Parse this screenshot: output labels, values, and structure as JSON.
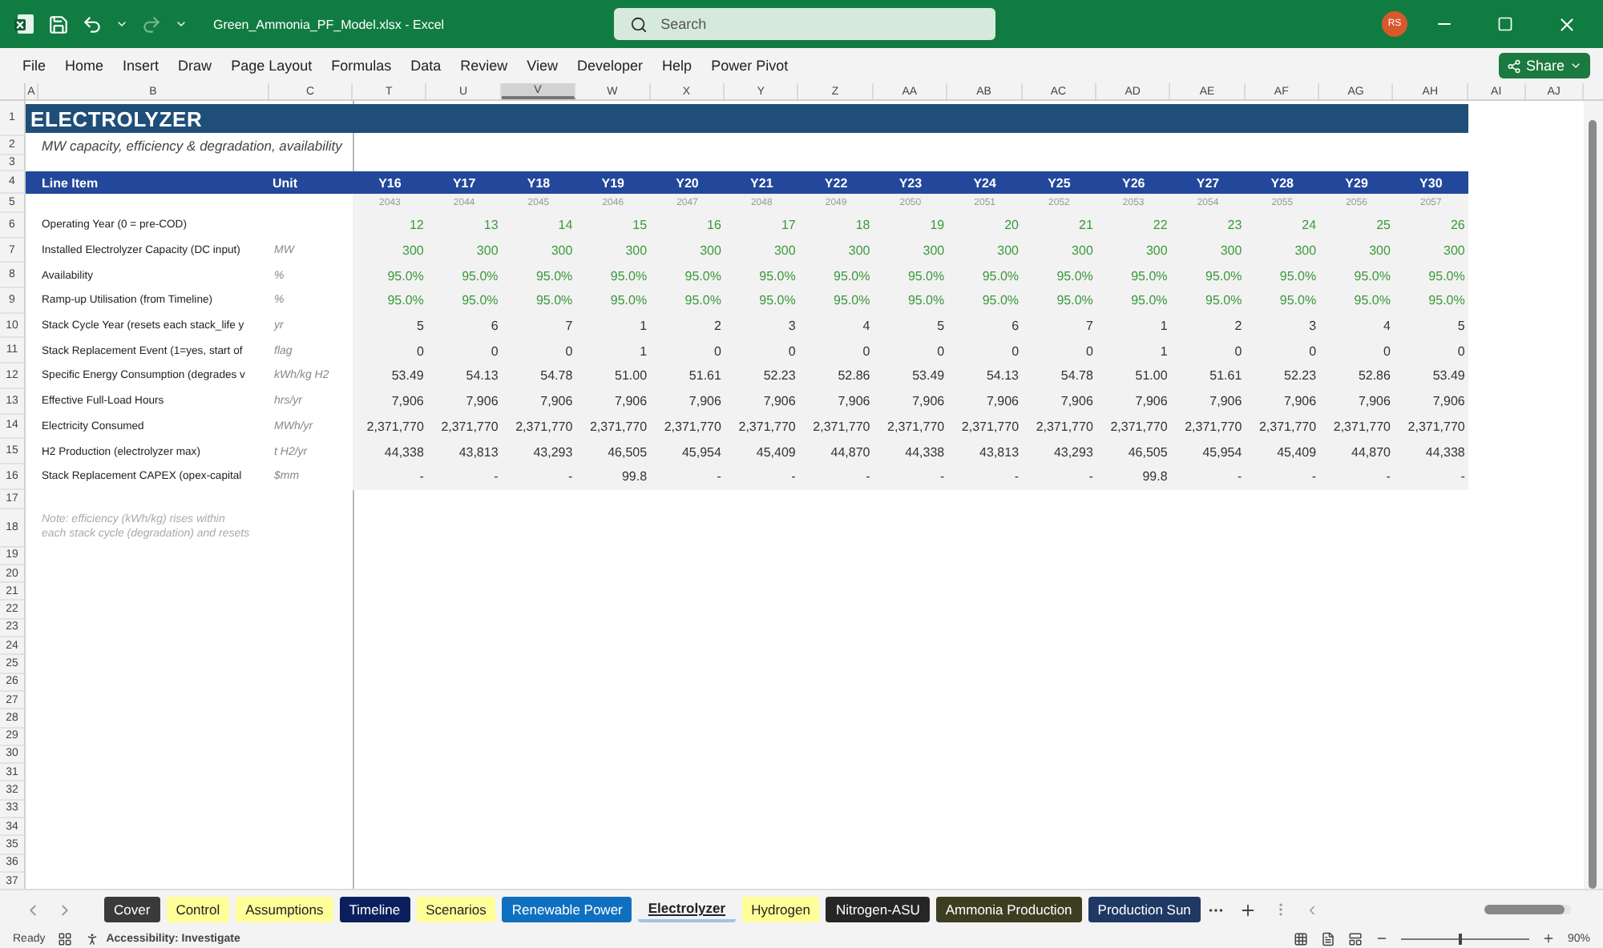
{
  "window": {
    "title": "Green_Ammonia_PF_Model.xlsx  -  Excel",
    "search": {
      "placeholder": "Search"
    },
    "user_initials": "RS"
  },
  "menu": [
    {
      "label": "File"
    },
    {
      "label": "Home"
    },
    {
      "label": "Insert"
    },
    {
      "label": "Draw"
    },
    {
      "label": "Page Layout"
    },
    {
      "label": "Formulas"
    },
    {
      "label": "Data"
    },
    {
      "label": "Review"
    },
    {
      "label": "View"
    },
    {
      "label": "Developer"
    },
    {
      "label": "Help"
    },
    {
      "label": "Power Pivot"
    }
  ],
  "share_button": "Share",
  "column_headers": [
    {
      "label": "A",
      "selected": false
    },
    {
      "label": "B",
      "selected": false
    },
    {
      "label": "C",
      "selected": false
    },
    {
      "label": "T",
      "selected": false
    },
    {
      "label": "U",
      "selected": false
    },
    {
      "label": "V",
      "selected": true
    },
    {
      "label": "W",
      "selected": false
    },
    {
      "label": "X",
      "selected": false
    },
    {
      "label": "Y",
      "selected": false
    },
    {
      "label": "Z",
      "selected": false
    },
    {
      "label": "AA",
      "selected": false
    },
    {
      "label": "AB",
      "selected": false
    },
    {
      "label": "AC",
      "selected": false
    },
    {
      "label": "AD",
      "selected": false
    },
    {
      "label": "AE",
      "selected": false
    },
    {
      "label": "AF",
      "selected": false
    },
    {
      "label": "AG",
      "selected": false
    },
    {
      "label": "AH",
      "selected": false
    },
    {
      "label": "AI",
      "selected": false
    },
    {
      "label": "AJ",
      "selected": false
    }
  ],
  "row_numbers": [
    "1",
    "2",
    "3",
    "4",
    "5",
    "6",
    "7",
    "8",
    "9",
    "10",
    "11",
    "12",
    "13",
    "14",
    "15",
    "16",
    "17",
    "18",
    "19",
    "20",
    "21",
    "22",
    "23",
    "24",
    "25",
    "26",
    "27",
    "28",
    "29",
    "30",
    "31",
    "32",
    "33",
    "34",
    "35",
    "36",
    "37"
  ],
  "sheet": {
    "title": "ELECTROLYZER",
    "subtitle": "MW capacity, efficiency & degradation, availability",
    "header": {
      "line_item": "Line Item",
      "unit": "Unit",
      "years": [
        "Y16",
        "Y17",
        "Y18",
        "Y19",
        "Y20",
        "Y21",
        "Y22",
        "Y23",
        "Y24",
        "Y25",
        "Y26",
        "Y27",
        "Y28",
        "Y29",
        "Y30"
      ],
      "dates": [
        "2043",
        "2044",
        "2045",
        "2046",
        "2047",
        "2048",
        "2049",
        "2050",
        "2051",
        "2052",
        "2053",
        "2054",
        "2055",
        "2056",
        "2057"
      ]
    },
    "rows": [
      {
        "label": "Operating Year (0 = pre-COD)",
        "unit": "",
        "kind": "input",
        "values": [
          "12",
          "13",
          "14",
          "15",
          "16",
          "17",
          "18",
          "19",
          "20",
          "21",
          "22",
          "23",
          "24",
          "25",
          "26"
        ]
      },
      {
        "label": "Installed Electrolyzer Capacity (DC input)",
        "unit": "MW",
        "kind": "input",
        "values": [
          "300",
          "300",
          "300",
          "300",
          "300",
          "300",
          "300",
          "300",
          "300",
          "300",
          "300",
          "300",
          "300",
          "300",
          "300"
        ]
      },
      {
        "label": "Availability",
        "unit": "%",
        "kind": "input",
        "values": [
          "95.0%",
          "95.0%",
          "95.0%",
          "95.0%",
          "95.0%",
          "95.0%",
          "95.0%",
          "95.0%",
          "95.0%",
          "95.0%",
          "95.0%",
          "95.0%",
          "95.0%",
          "95.0%",
          "95.0%"
        ]
      },
      {
        "label": "Ramp-up Utilisation (from Timeline)",
        "unit": "%",
        "kind": "input",
        "values": [
          "95.0%",
          "95.0%",
          "95.0%",
          "95.0%",
          "95.0%",
          "95.0%",
          "95.0%",
          "95.0%",
          "95.0%",
          "95.0%",
          "95.0%",
          "95.0%",
          "95.0%",
          "95.0%",
          "95.0%"
        ]
      },
      {
        "label": "Stack Cycle Year (resets each stack_life y",
        "unit": "yr",
        "kind": "calc",
        "values": [
          "5",
          "6",
          "7",
          "1",
          "2",
          "3",
          "4",
          "5",
          "6",
          "7",
          "1",
          "2",
          "3",
          "4",
          "5"
        ]
      },
      {
        "label": "Stack Replacement Event (1=yes, start of",
        "unit": "flag",
        "kind": "calc",
        "values": [
          "0",
          "0",
          "0",
          "1",
          "0",
          "0",
          "0",
          "0",
          "0",
          "0",
          "1",
          "0",
          "0",
          "0",
          "0"
        ]
      },
      {
        "label": "Specific Energy Consumption (degrades v",
        "unit": "kWh/kg H2",
        "kind": "calc",
        "values": [
          "53.49",
          "54.13",
          "54.78",
          "51.00",
          "51.61",
          "52.23",
          "52.86",
          "53.49",
          "54.13",
          "54.78",
          "51.00",
          "51.61",
          "52.23",
          "52.86",
          "53.49"
        ]
      },
      {
        "label": "Effective Full-Load Hours",
        "unit": "hrs/yr",
        "kind": "calc",
        "values": [
          "7,906",
          "7,906",
          "7,906",
          "7,906",
          "7,906",
          "7,906",
          "7,906",
          "7,906",
          "7,906",
          "7,906",
          "7,906",
          "7,906",
          "7,906",
          "7,906",
          "7,906"
        ]
      },
      {
        "label": "Electricity Consumed",
        "unit": "MWh/yr",
        "kind": "calc",
        "values": [
          "2,371,770",
          "2,371,770",
          "2,371,770",
          "2,371,770",
          "2,371,770",
          "2,371,770",
          "2,371,770",
          "2,371,770",
          "2,371,770",
          "2,371,770",
          "2,371,770",
          "2,371,770",
          "2,371,770",
          "2,371,770",
          "2,371,770"
        ]
      },
      {
        "label": "H2 Production (electrolyzer max)",
        "unit": "t H2/yr",
        "kind": "calc",
        "values": [
          "44,338",
          "43,813",
          "43,293",
          "46,505",
          "45,954",
          "45,409",
          "44,870",
          "44,338",
          "43,813",
          "43,293",
          "46,505",
          "45,954",
          "45,409",
          "44,870",
          "44,338"
        ]
      },
      {
        "label": "Stack Replacement CAPEX (opex-capital",
        "unit": "$mm",
        "kind": "calc",
        "values": [
          "-",
          "-",
          "-",
          "99.8",
          "-",
          "-",
          "-",
          "-",
          "-",
          "-",
          "99.8",
          "-",
          "-",
          "-",
          "-"
        ]
      }
    ],
    "note": [
      "Note: efficiency (kWh/kg) rises within",
      "each stack cycle (degradation) and resets"
    ]
  },
  "sheet_tabs": [
    {
      "label": "Cover",
      "color": "#3a3a3a",
      "selected": false
    },
    {
      "label": "Control",
      "color": "#ffff99",
      "selected": false
    },
    {
      "label": "Assumptions",
      "color": "#ffff99",
      "selected": false
    },
    {
      "label": "Timeline",
      "color": "#0b1f5c",
      "selected": false
    },
    {
      "label": "Scenarios",
      "color": "#ffff99",
      "selected": false
    },
    {
      "label": "Renewable Power",
      "color": "#1070c0",
      "selected": false
    },
    {
      "label": "Electrolyzer",
      "color": "#9dc3e6",
      "selected": true
    },
    {
      "label": "Hydrogen",
      "color": "#ffff99",
      "selected": false
    },
    {
      "label": "Nitrogen-ASU",
      "color": "#262626",
      "selected": false
    },
    {
      "label": "Ammonia Production",
      "color": "#3d3d22",
      "selected": false
    },
    {
      "label": "Production Sun",
      "color": "#1f3864",
      "selected": false
    }
  ],
  "status_bar": {
    "ready": "Ready",
    "accessibility": "Accessibility: Investigate",
    "zoom": {
      "reading": "90%",
      "level": 0.45
    }
  }
}
